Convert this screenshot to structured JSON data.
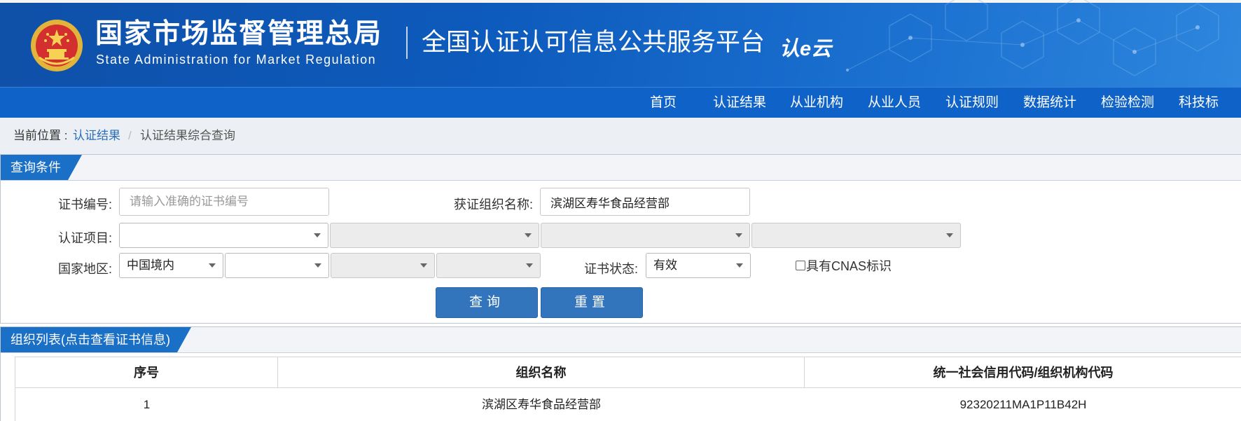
{
  "header": {
    "agency_cn": "国家市场监督管理总局",
    "agency_en": "State Administration for Market Regulation",
    "platform_name": "全国认证认可信息公共服务平台",
    "brand_logo": "认e云",
    "emblem_icon": "national-emblem-icon",
    "colors": {
      "banner": "#0d5bbd",
      "nav": "#0f63c8",
      "accent": "#1a6fc6",
      "button": "#3375bd",
      "link": "#2b6fb8"
    }
  },
  "nav": {
    "items": [
      {
        "label": "首页"
      },
      {
        "label": "认证结果"
      },
      {
        "label": "从业机构"
      },
      {
        "label": "从业人员"
      },
      {
        "label": "认证规则"
      },
      {
        "label": "数据统计"
      },
      {
        "label": "检验检测"
      },
      {
        "label": "科技标"
      }
    ]
  },
  "breadcrumb": {
    "prefix": "当前位置 :",
    "link": "认证结果",
    "separator": "/",
    "current": "认证结果综合查询"
  },
  "query_panel": {
    "title": "查询条件",
    "cert_number": {
      "label": "证书编号:",
      "value": "",
      "placeholder": "请输入准确的证书编号"
    },
    "org_name": {
      "label": "获证组织名称:",
      "value": "滨湖区寿华食品经营部"
    },
    "cert_item": {
      "label": "认证项目:",
      "selects": [
        "",
        "",
        "",
        ""
      ]
    },
    "region": {
      "label": "国家地区:",
      "country": "中国境内",
      "selects": [
        "",
        "",
        ""
      ]
    },
    "cert_status": {
      "label": "证书状态:",
      "value": "有效"
    },
    "cnas": {
      "label": "具有CNAS标识",
      "checked": false
    },
    "query_button": "查询",
    "reset_button": "重置"
  },
  "org_list": {
    "title": "组织列表(点击查看证书信息)",
    "columns": [
      "序号",
      "组织名称",
      "统一社会信用代码/组织机构代码"
    ],
    "rows": [
      [
        "1",
        "滨湖区寿华食品经营部",
        "92320211MA1P11B42H"
      ]
    ]
  }
}
